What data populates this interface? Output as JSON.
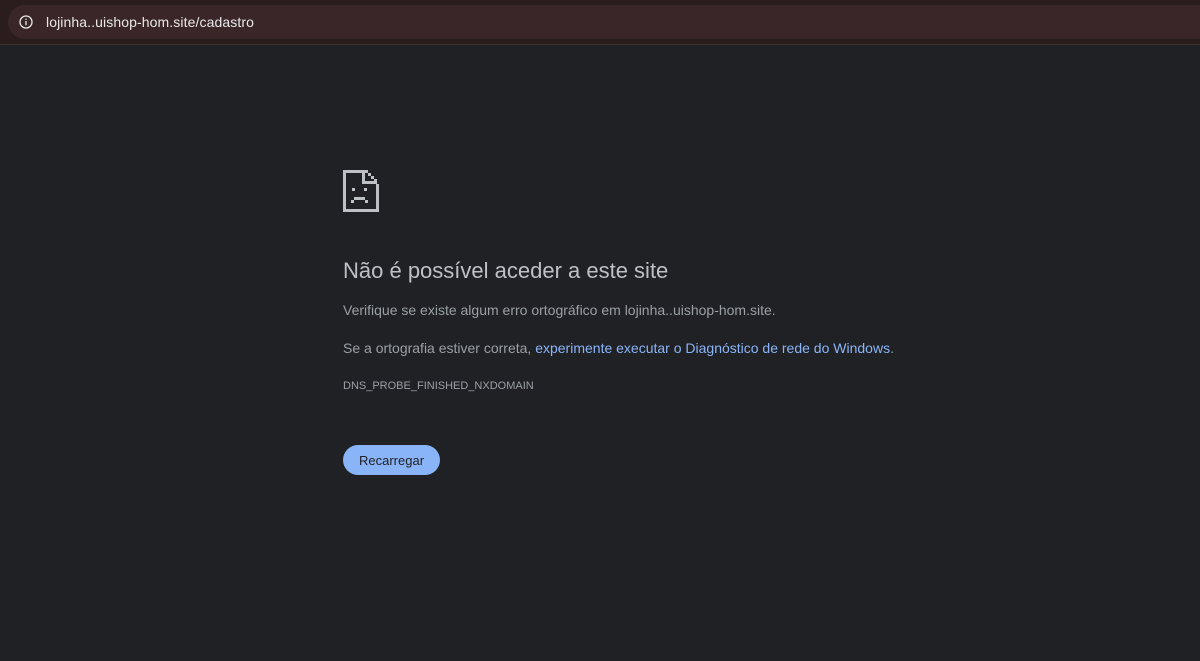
{
  "browser": {
    "url": "lojinha..uishop-hom.site/cadastro",
    "site_info_icon": "info-circle-icon"
  },
  "error": {
    "icon": "sad-page-icon",
    "title": "Não é possível aceder a este site",
    "spell_check_text": "Verifique se existe algum erro ortográfico em lojinha..uishop-hom.site.",
    "suggestion_prefix": "Se a ortografia estiver correta, ",
    "suggestion_link": "experimente executar o Diagnóstico de rede do Windows",
    "suggestion_suffix": ".",
    "error_code": "DNS_PROBE_FINISHED_NXDOMAIN",
    "reload_label": "Recarregar"
  },
  "colors": {
    "page_background": "#202124",
    "address_bar": "#3a2628",
    "link": "#8ab4f8",
    "button": "#8ab4f8"
  }
}
